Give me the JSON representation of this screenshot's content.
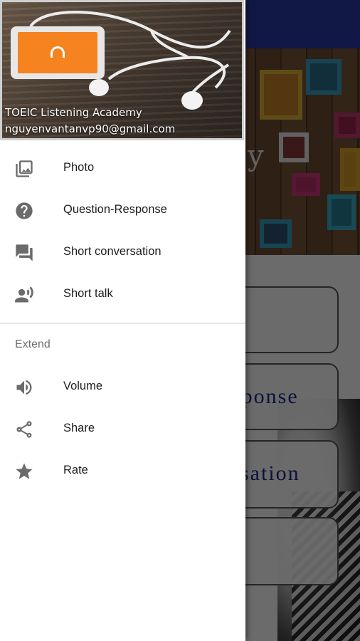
{
  "app": {
    "title_fragment": "my",
    "banner_letter": "y",
    "buttons": [
      "",
      "sponse",
      "rsation",
      ""
    ]
  },
  "drawer": {
    "header": {
      "title": "TOEIC Listening Academy",
      "email": "nguyenvantanvp90@gmail.com"
    },
    "main_items": [
      {
        "label": "Photo",
        "icon": "photo-icon"
      },
      {
        "label": "Question-Response",
        "icon": "help-circle-icon"
      },
      {
        "label": "Short conversation",
        "icon": "chat-icon"
      },
      {
        "label": "Short talk",
        "icon": "speaker-person-icon"
      }
    ],
    "section_title": "Extend",
    "extend_items": [
      {
        "label": "Volume",
        "icon": "volume-icon"
      },
      {
        "label": "Share",
        "icon": "share-icon"
      },
      {
        "label": "Rate",
        "icon": "star-icon"
      }
    ]
  }
}
